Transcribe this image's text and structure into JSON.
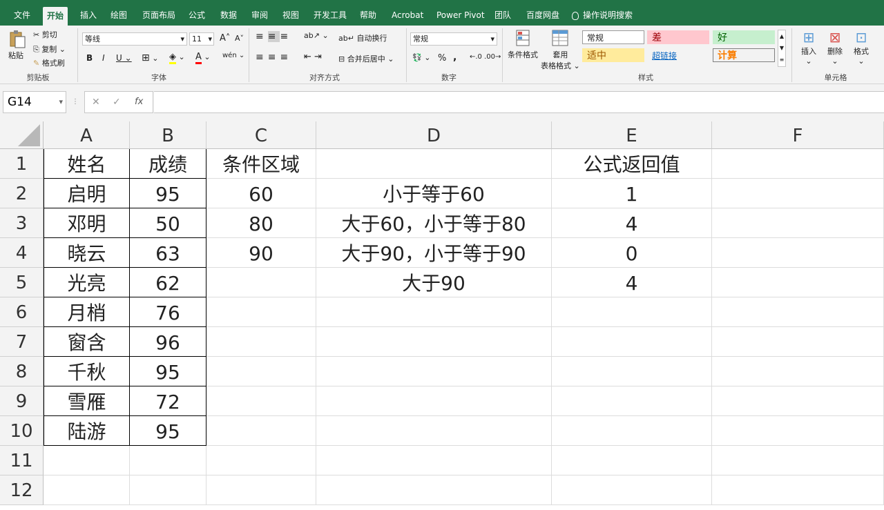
{
  "tabs": [
    "文件",
    "开始",
    "插入",
    "绘图",
    "页面布局",
    "公式",
    "数据",
    "审阅",
    "视图",
    "开发工具",
    "帮助",
    "Acrobat",
    "Power Pivot",
    "团队",
    "百度网盘"
  ],
  "tell_me": "操作说明搜索",
  "ribbon": {
    "clipboard": {
      "paste": "粘贴",
      "cut": "剪切",
      "copy": "复制",
      "format_painter": "格式刷",
      "label": "剪贴板"
    },
    "font": {
      "name": "等线",
      "size": "11",
      "bold": "B",
      "italic": "I",
      "underline": "U",
      "inc": "A",
      "dec": "A",
      "label": "字体",
      "pinyin": "wén"
    },
    "align": {
      "wrap": "自动换行",
      "merge": "合并后居中",
      "label": "对齐方式"
    },
    "number": {
      "format": "常规",
      "percent": "%",
      "comma": ",",
      "label": "数字"
    },
    "styles": {
      "cond_format": "条件格式",
      "table_format_1": "套用",
      "table_format_2": "表格格式",
      "label": "样式",
      "items": [
        {
          "text": "常规",
          "color": "#222222",
          "bg": "#ffffff"
        },
        {
          "text": "差",
          "color": "#9c0006",
          "bg": "#ffc7ce"
        },
        {
          "text": "好",
          "color": "#006100",
          "bg": "#c6efce"
        },
        {
          "text": "适中",
          "color": "#9c5700",
          "bg": "#ffeb9c"
        },
        {
          "text": "超链接",
          "color": "#0563c1",
          "bg": "transparent"
        },
        {
          "text": "计算",
          "color": "#fa7d00",
          "bg": "#f2f2f2"
        }
      ]
    },
    "cells": {
      "insert": "插入",
      "delete": "删除",
      "format": "格式",
      "label": "单元格"
    }
  },
  "formula_bar": {
    "name_box": "G14",
    "fx": "fx",
    "content": ""
  },
  "columns": [
    "A",
    "B",
    "C",
    "D",
    "E",
    "F"
  ],
  "rows": [
    "1",
    "2",
    "3",
    "4",
    "5",
    "6",
    "7",
    "8",
    "9",
    "10",
    "11",
    "12"
  ],
  "sheet": {
    "A": [
      "姓名",
      "启明",
      "邓明",
      "晓云",
      "光亮",
      "月梢",
      "窗含",
      "千秋",
      "雪雁",
      "陆游",
      "",
      ""
    ],
    "B": [
      "成绩",
      "95",
      "50",
      "63",
      "62",
      "76",
      "96",
      "95",
      "72",
      "95",
      "",
      ""
    ],
    "C": [
      "条件区域",
      "60",
      "80",
      "90",
      "",
      "",
      "",
      "",
      "",
      "",
      "",
      ""
    ],
    "D": [
      "",
      "小于等于60",
      "大于60，小于等于80",
      "大于90，小于等于90",
      "大于90",
      "",
      "",
      "",
      "",
      "",
      "",
      ""
    ],
    "E": [
      "公式返回值",
      "1",
      "4",
      "0",
      "4",
      "",
      "",
      "",
      "",
      "",
      "",
      ""
    ],
    "F": [
      "",
      "",
      "",
      "",
      "",
      "",
      "",
      "",
      "",
      "",
      "",
      ""
    ]
  }
}
